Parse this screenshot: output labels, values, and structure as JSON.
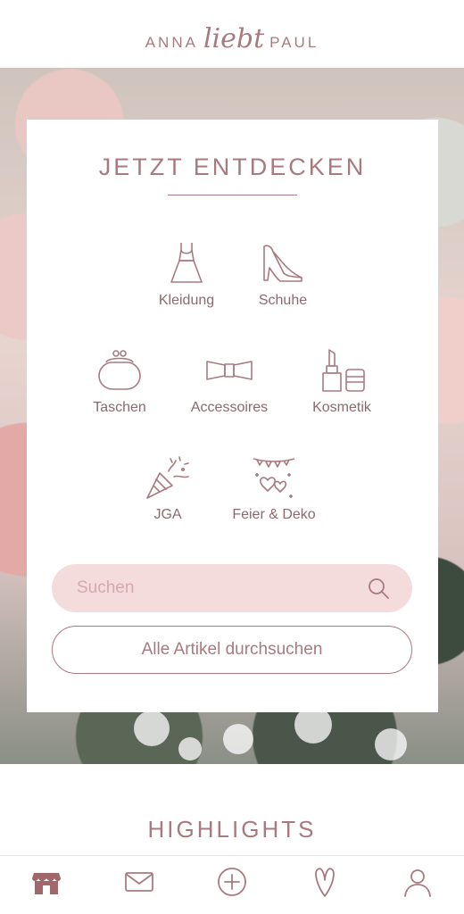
{
  "header": {
    "logo_left": "ANNA",
    "logo_middle": "liebt",
    "logo_right": "PAUL"
  },
  "card": {
    "title": "JETZT ENTDECKEN",
    "categories": [
      {
        "label": "Kleidung",
        "icon": "dress-icon"
      },
      {
        "label": "Schuhe",
        "icon": "high-heel-icon"
      },
      {
        "label": "Taschen",
        "icon": "purse-icon"
      },
      {
        "label": "Accessoires",
        "icon": "bow-tie-icon"
      },
      {
        "label": "Kosmetik",
        "icon": "lipstick-icon"
      },
      {
        "label": "JGA",
        "icon": "party-popper-icon"
      },
      {
        "label": "Feier & Deko",
        "icon": "garland-hearts-icon"
      }
    ],
    "search": {
      "placeholder": "Suchen"
    },
    "browse_all_label": "Alle Artikel durchsuchen"
  },
  "section": {
    "title": "HIGHLIGHTS"
  },
  "tabbar": {
    "items": [
      {
        "icon": "shop-icon",
        "active": true
      },
      {
        "icon": "mail-icon",
        "active": false
      },
      {
        "icon": "plus-circle-icon",
        "active": false
      },
      {
        "icon": "heart-icon",
        "active": false
      },
      {
        "icon": "user-icon",
        "active": false
      }
    ]
  },
  "colors": {
    "accent": "#a87a80",
    "search_bg": "#f3dcdb",
    "active_tab": "#a1686c"
  }
}
